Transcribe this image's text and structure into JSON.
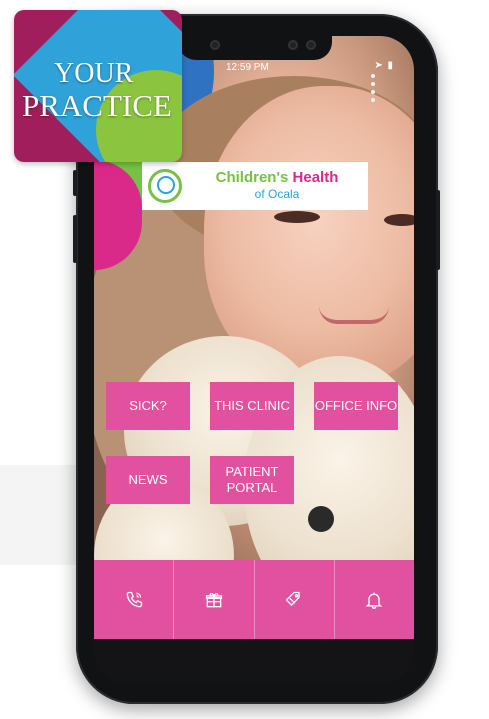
{
  "brand": {
    "your_practice_line1": "YOUR",
    "your_practice_line2": "PRACTICE"
  },
  "status_bar": {
    "time": "12:59 PM"
  },
  "clinic_logo": {
    "name_part1": "Children's",
    "name_part2": "Health",
    "subtitle": "of Ocala"
  },
  "tiles": [
    {
      "label": "SICK?"
    },
    {
      "label": "THIS CLINIC"
    },
    {
      "label": "OFFICE INFO"
    },
    {
      "label": "NEWS"
    },
    {
      "label": "PATIENT PORTAL"
    }
  ],
  "bottom_nav": [
    {
      "icon": "phone-icon"
    },
    {
      "icon": "gift-icon"
    },
    {
      "icon": "tag-icon"
    },
    {
      "icon": "bell-icon"
    }
  ],
  "colors": {
    "primary_pink": "#e2519f",
    "brand_magenta": "#a01e5b",
    "brand_blue": "#2fa3d9",
    "brand_green": "#77c143"
  }
}
